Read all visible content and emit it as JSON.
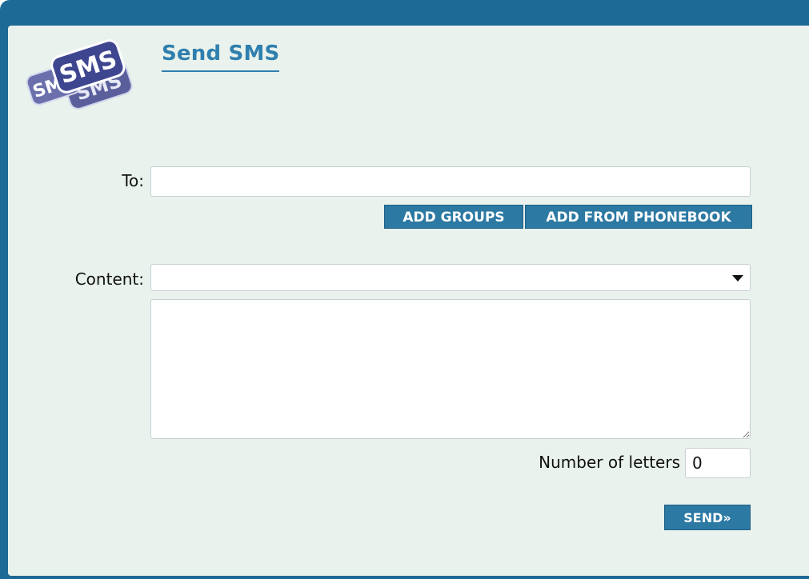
{
  "header": {
    "title": "Send SMS",
    "logo_text": "SMS"
  },
  "form": {
    "to_label": "To:",
    "to_value": "",
    "add_groups_label": "ADD GROUPS",
    "add_phonebook_label": "ADD FROM PHONEBOOK",
    "content_label": "Content:",
    "content_selected": "",
    "message_value": "",
    "num_letters_label": "Number of letters",
    "num_letters_value": "0",
    "send_label": "SEND»"
  },
  "colors": {
    "frame": "#1d6a96",
    "panel": "#e9f2ec",
    "accent": "#2c79a3",
    "title": "#2f7fae"
  }
}
